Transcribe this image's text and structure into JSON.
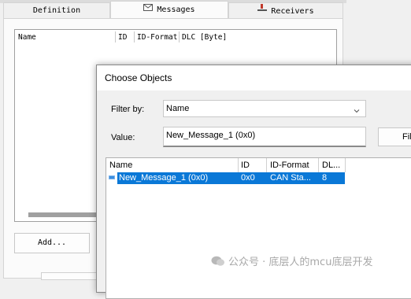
{
  "background_window": {
    "tabs": [
      {
        "label": "Definition",
        "icon": "none",
        "active": false
      },
      {
        "label": "Messages",
        "icon": "envelope-icon",
        "active": true
      },
      {
        "label": "Receivers",
        "icon": "receiver-icon",
        "active": false
      }
    ],
    "columns": [
      "Name",
      "ID",
      "ID-Format",
      "DLC [Byte]"
    ],
    "add_button": "Add..."
  },
  "dialog": {
    "title": "Choose Objects",
    "filter_label": "Filter by:",
    "filter_value": "Name",
    "value_label": "Value:",
    "value_text": "New_Message_1 (0x0)",
    "filter_button": "Fil",
    "columns": [
      "Name",
      "ID",
      "ID-Format",
      "DL..."
    ],
    "rows": [
      {
        "name": "New_Message_1 (0x0)",
        "id": "0x0",
        "format": "CAN Sta...",
        "dlc": "8"
      }
    ]
  },
  "watermark": "公众号 · 底层人的mcu底层开发",
  "colors": {
    "selection": "#0a78d7",
    "icon_red": "#c0392b"
  }
}
